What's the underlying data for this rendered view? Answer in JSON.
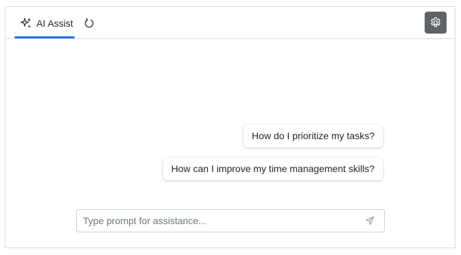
{
  "header": {
    "tab_label": "AI Assist",
    "tab_icon": "sparkle-icon",
    "refresh_icon": "refresh-icon",
    "settings_icon": "gear-icon"
  },
  "suggestions": [
    "How do I prioritize my tasks?",
    "How can I improve my time management skills?"
  ],
  "prompt": {
    "placeholder": "Type prompt for assistance...",
    "value": "",
    "send_icon": "send-icon"
  },
  "colors": {
    "accent": "#1a73e8",
    "settings_bg": "#5f6368",
    "border": "#dcdcdc"
  }
}
